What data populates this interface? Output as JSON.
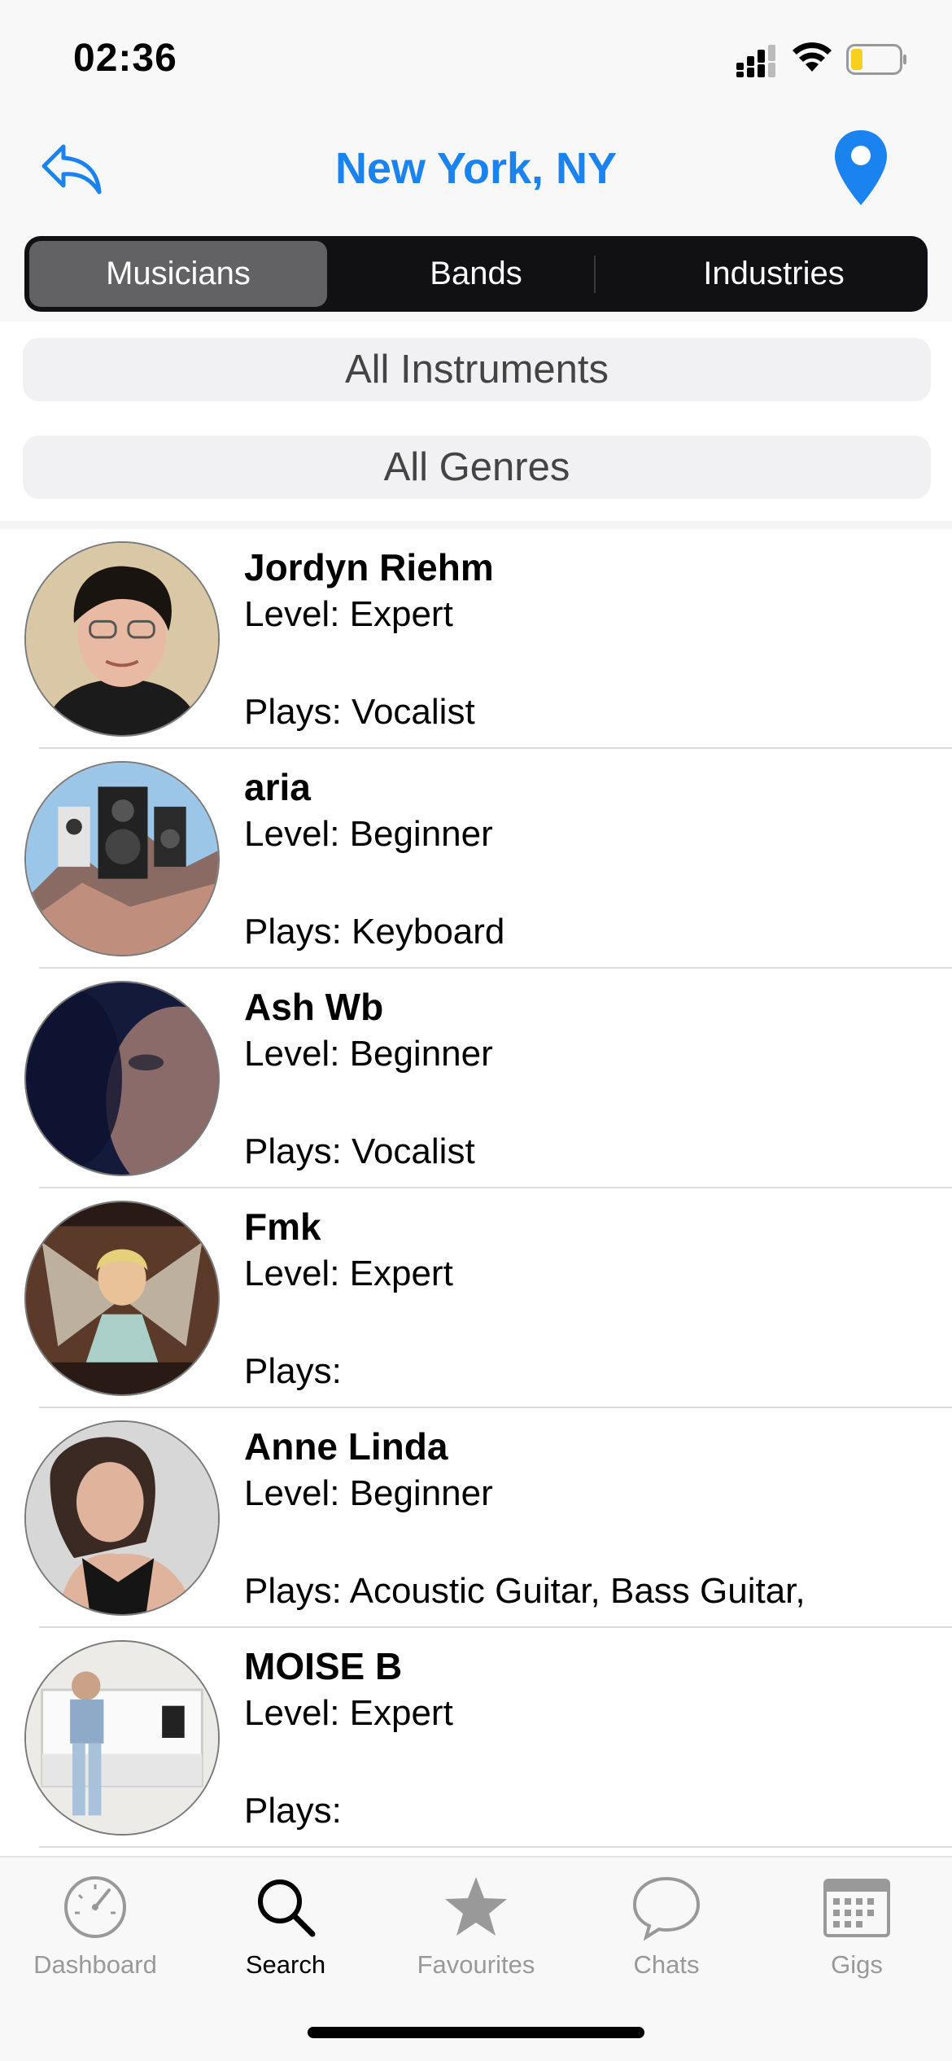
{
  "status": {
    "time": "02:36"
  },
  "nav": {
    "title": "New York, NY",
    "back_icon": "reply-back-icon",
    "pin_icon": "location-pin-icon"
  },
  "segments": [
    {
      "label": "Musicians",
      "selected": true
    },
    {
      "label": "Bands",
      "selected": false
    },
    {
      "label": "Industries",
      "selected": false
    }
  ],
  "filters": {
    "instruments": "All Instruments",
    "genres": "All Genres"
  },
  "musicians": [
    {
      "name": "Jordyn Riehm",
      "level": "Level: Expert",
      "plays": "Plays: Vocalist"
    },
    {
      "name": "aria",
      "level": "Level: Beginner",
      "plays": "Plays: Keyboard"
    },
    {
      "name": "Ash Wb",
      "level": "Level: Beginner",
      "plays": "Plays: Vocalist"
    },
    {
      "name": "Fmk",
      "level": "Level: Expert",
      "plays": "Plays:"
    },
    {
      "name": "Anne Linda",
      "level": "Level: Beginner",
      "plays": "Plays: Acoustic Guitar, Bass Guitar,"
    },
    {
      "name": "MOISE B",
      "level": "Level: Expert",
      "plays": "Plays:"
    }
  ],
  "tabs": [
    {
      "label": "Dashboard",
      "icon": "speedometer-icon",
      "active": false
    },
    {
      "label": "Search",
      "icon": "search-icon",
      "active": true
    },
    {
      "label": "Favourites",
      "icon": "star-icon",
      "active": false
    },
    {
      "label": "Chats",
      "icon": "chat-bubble-icon",
      "active": false
    },
    {
      "label": "Gigs",
      "icon": "calendar-icon",
      "active": false
    }
  ],
  "colors": {
    "accent": "#1a83f0",
    "segment_bg": "#111113",
    "segment_selected": "#626264"
  }
}
